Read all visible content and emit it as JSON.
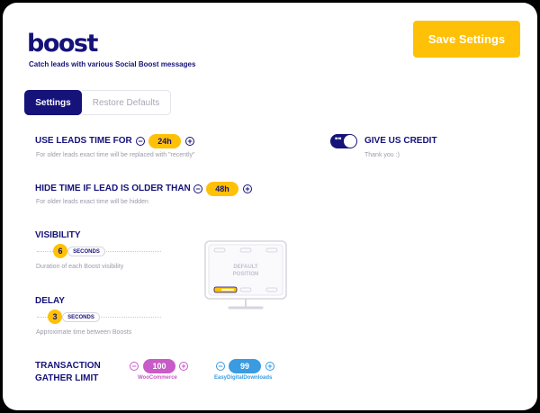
{
  "header": {
    "logo_text": "boost",
    "tagline": "Catch leads with various Social Boost messages",
    "save_label": "Save Settings"
  },
  "tabs": [
    {
      "label": "Settings",
      "active": true
    },
    {
      "label": "Restore Defaults",
      "active": false
    }
  ],
  "settings": {
    "leads_time": {
      "label": "USE LEADS TIME FOR",
      "value": "24h",
      "help": "For older leads exact time will be replaced with \"recently\""
    },
    "hide_time": {
      "label": "HIDE TIME IF LEAD IS OLDER THAN",
      "value": "48h",
      "help": "For older leads exact time will be hidden"
    },
    "visibility": {
      "label": "VISIBILITY",
      "value": "6",
      "unit": "SECONDS",
      "help": "Duration of each Boost visibility"
    },
    "delay": {
      "label": "DELAY",
      "value": "3",
      "unit": "SECONDS",
      "help": "Approximate time between Boosts"
    },
    "transaction": {
      "label_line1": "TRANSACTION",
      "label_line2": "GATHER LIMIT",
      "woocommerce": {
        "value": "100",
        "name": "WooCommerce",
        "color": "#c85bc8"
      },
      "edd": {
        "value": "99",
        "name": "EasyDigitalDownloads",
        "color": "#3a9be0"
      }
    }
  },
  "credit": {
    "label": "GIVE US CREDIT",
    "help": "Thank you :)",
    "enabled": true
  },
  "position": {
    "line1": "DEFAULT",
    "line2": "POSITION"
  },
  "icons": {
    "minus": "−",
    "plus": "+"
  },
  "colors": {
    "brand": "#15127a",
    "accent": "#ffc107"
  }
}
